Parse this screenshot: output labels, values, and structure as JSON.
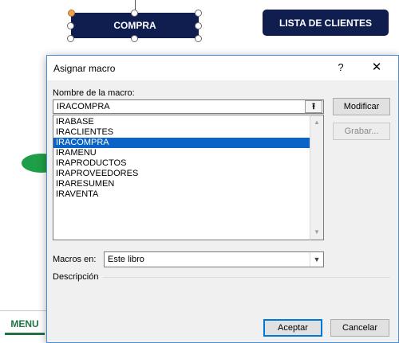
{
  "sheet": {
    "compra_button": "COMPRA",
    "clientes_button": "LISTA DE CLIENTES",
    "sheet_tab": "MENU"
  },
  "dialog": {
    "title": "Asignar macro",
    "help": "?",
    "close": "✕",
    "name_label": "Nombre de la macro:",
    "name_value": "IRACOMPRA",
    "ref_icon": "⭱",
    "macros": [
      "IRABASE",
      "IRACLIENTES",
      "IRACOMPRA",
      "IRAMENU",
      "IRAPRODUCTOS",
      "IRAPROVEEDORES",
      "IRARESUMEN",
      "IRAVENTA"
    ],
    "selected_macro": "IRACOMPRA",
    "modify_button": "Modificar",
    "record_button": "Grabar...",
    "macros_in_label": "Macros en:",
    "macros_in_value": "Este libro",
    "description_label": "Descripción",
    "accept_button": "Aceptar",
    "cancel_button": "Cancelar"
  },
  "colors": {
    "button_navy": "#0f1e4f",
    "selection_blue": "#0a64c8",
    "sheet_tab_green": "#217346",
    "oval_green": "#1e9e46"
  }
}
